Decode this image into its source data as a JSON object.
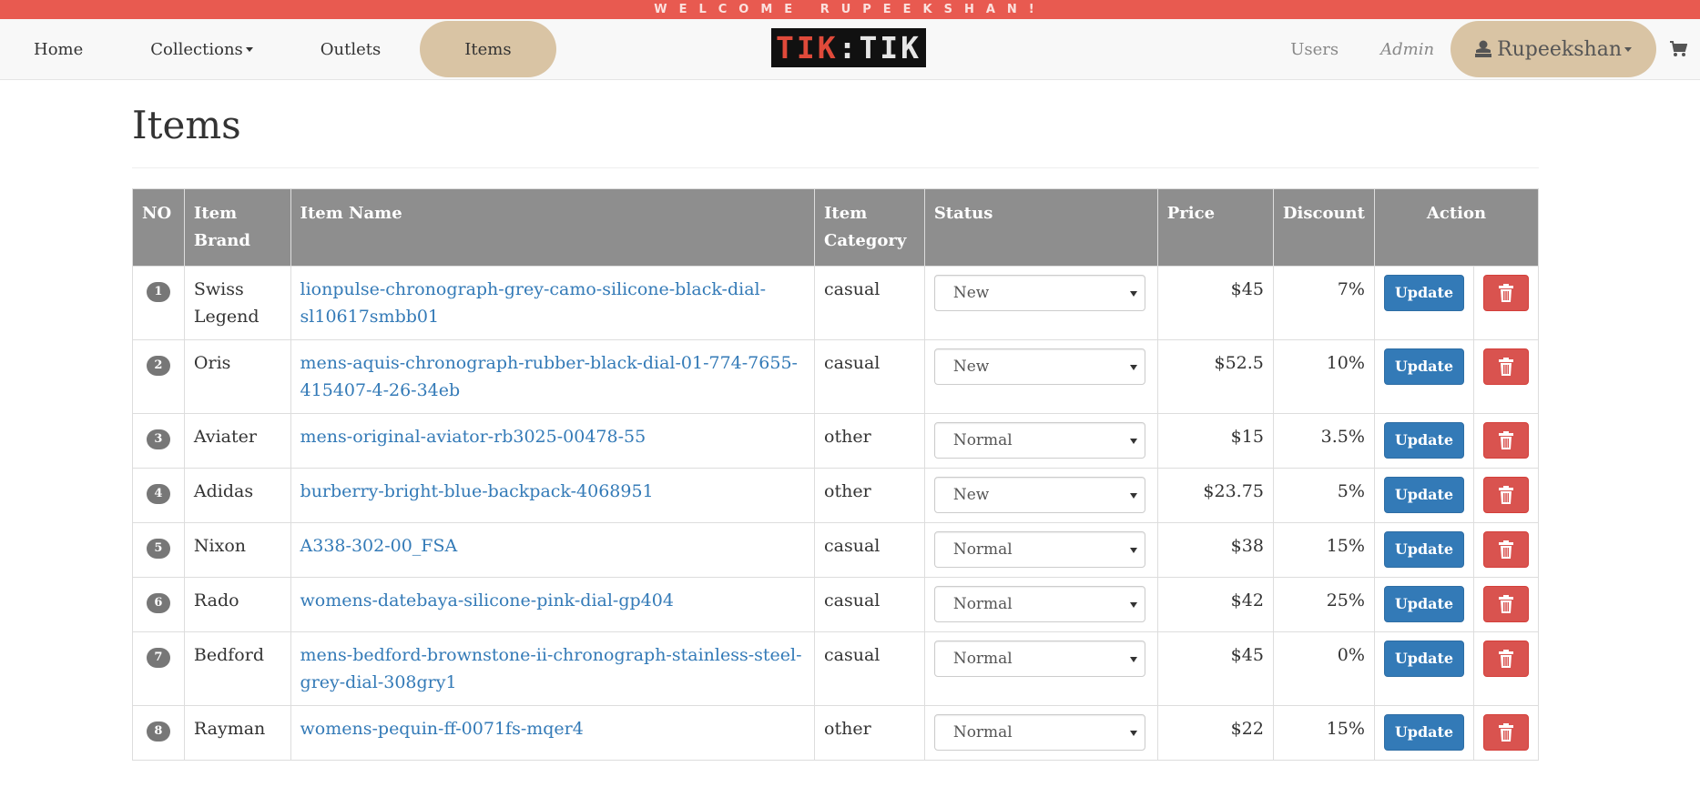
{
  "banner": {
    "welcome_text": "WELCOME  RUPEEKSHAN!"
  },
  "nav": {
    "home": "Home",
    "collections": "Collections",
    "outlets": "Outlets",
    "items": "Items",
    "logo_left": "TIK",
    "logo_sep": ":",
    "logo_right": "TIK",
    "users": "Users",
    "admin": "Admin",
    "user_name": "Rupeekshan",
    "icons": [
      "user-icon",
      "cart-icon"
    ]
  },
  "page": {
    "title": "Items"
  },
  "table": {
    "headers": {
      "no": "NO",
      "brand_line1": "Item",
      "brand_line2": "Brand",
      "name": "Item Name",
      "category_line1": "Item",
      "category_line2": "Category",
      "status": "Status",
      "price": "Price",
      "discount": "Discount",
      "action": "Action"
    },
    "update_label": "Update",
    "rows": [
      {
        "no": "1",
        "brand": "Swiss Legend",
        "name": "lionpulse-chronograph-grey-camo-silicone-black-dial-sl10617smbb01",
        "category": "casual",
        "status": "New",
        "price": "$45",
        "discount": "7%"
      },
      {
        "no": "2",
        "brand": "Oris",
        "name": "mens-aquis-chronograph-rubber-black-dial-01-774-7655-415407-4-26-34eb",
        "category": "casual",
        "status": "New",
        "price": "$52.5",
        "discount": "10%"
      },
      {
        "no": "3",
        "brand": "Aviater",
        "name": "mens-original-aviator-rb3025-00478-55",
        "category": "other",
        "status": "Normal",
        "price": "$15",
        "discount": "3.5%"
      },
      {
        "no": "4",
        "brand": "Adidas",
        "name": "burberry-bright-blue-backpack-4068951",
        "category": "other",
        "status": "New",
        "price": "$23.75",
        "discount": "5%"
      },
      {
        "no": "5",
        "brand": "Nixon",
        "name": "A338-302-00_FSA",
        "category": "casual",
        "status": "Normal",
        "price": "$38",
        "discount": "15%"
      },
      {
        "no": "6",
        "brand": "Rado",
        "name": "womens-datebaya-silicone-pink-dial-gp404",
        "category": "casual",
        "status": "Normal",
        "price": "$42",
        "discount": "25%"
      },
      {
        "no": "7",
        "brand": "Bedford",
        "name": "mens-bedford-brownstone-ii-chronograph-stainless-steel-grey-dial-308gry1",
        "category": "casual",
        "status": "Normal",
        "price": "$45",
        "discount": "0%"
      },
      {
        "no": "8",
        "brand": "Rayman",
        "name": "womens-pequin-ff-0071fs-mqer4",
        "category": "other",
        "status": "Normal",
        "price": "$22",
        "discount": "15%"
      }
    ]
  },
  "colors": {
    "banner": "#e85a50",
    "active_nav": "#d9c4a4",
    "update_button": "#337ab7",
    "delete_button": "#d9534f",
    "header": "#8e8e8e",
    "link": "#337ab7"
  }
}
